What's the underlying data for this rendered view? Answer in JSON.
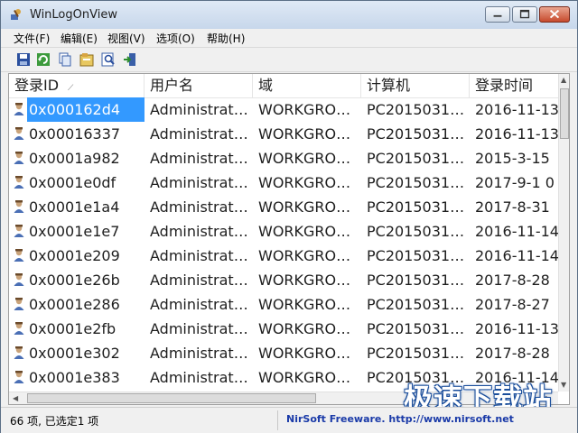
{
  "window": {
    "title": "WinLogOnView"
  },
  "menu": [
    {
      "label": "文件(F)"
    },
    {
      "label": "编辑(E)"
    },
    {
      "label": "视图(V)"
    },
    {
      "label": "选项(O)"
    },
    {
      "label": "帮助(H)"
    }
  ],
  "toolbar": [
    {
      "icon": "save-icon"
    },
    {
      "icon": "refresh-icon"
    },
    {
      "icon": "copy-icon"
    },
    {
      "icon": "properties-icon"
    },
    {
      "icon": "find-icon"
    },
    {
      "icon": "exit-icon"
    }
  ],
  "columns": [
    {
      "label": "登录ID",
      "sorted": true
    },
    {
      "label": "用户名"
    },
    {
      "label": "域"
    },
    {
      "label": "计算机"
    },
    {
      "label": "登录时间"
    }
  ],
  "rows": [
    {
      "id": "0x000162d4",
      "user": "Administrat…",
      "domain": "WORKGRO…",
      "computer": "PC2015031…",
      "time": "2016-11-13",
      "selected": true
    },
    {
      "id": "0x00016337",
      "user": "Administrat…",
      "domain": "WORKGRO…",
      "computer": "PC2015031…",
      "time": "2016-11-13"
    },
    {
      "id": "0x0001a982",
      "user": "Administrat…",
      "domain": "WORKGRO…",
      "computer": "PC2015031…",
      "time": "2015-3-15"
    },
    {
      "id": "0x0001e0df",
      "user": "Administrat…",
      "domain": "WORKGRO…",
      "computer": "PC2015031…",
      "time": "2017-9-1 0"
    },
    {
      "id": "0x0001e1a4",
      "user": "Administrat…",
      "domain": "WORKGRO…",
      "computer": "PC2015031…",
      "time": "2017-8-31"
    },
    {
      "id": "0x0001e1e7",
      "user": "Administrat…",
      "domain": "WORKGRO…",
      "computer": "PC2015031…",
      "time": "2016-11-14"
    },
    {
      "id": "0x0001e209",
      "user": "Administrat…",
      "domain": "WORKGRO…",
      "computer": "PC2015031…",
      "time": "2016-11-14"
    },
    {
      "id": "0x0001e26b",
      "user": "Administrat…",
      "domain": "WORKGRO…",
      "computer": "PC2015031…",
      "time": "2017-8-28"
    },
    {
      "id": "0x0001e286",
      "user": "Administrat…",
      "domain": "WORKGRO…",
      "computer": "PC2015031…",
      "time": "2017-8-27"
    },
    {
      "id": "0x0001e2fb",
      "user": "Administrat…",
      "domain": "WORKGRO…",
      "computer": "PC2015031…",
      "time": "2016-11-13"
    },
    {
      "id": "0x0001e302",
      "user": "Administrat…",
      "domain": "WORKGRO…",
      "computer": "PC2015031…",
      "time": "2017-8-28"
    },
    {
      "id": "0x0001e383",
      "user": "Administrat…",
      "domain": "WORKGRO…",
      "computer": "PC2015031…",
      "time": "2016-11-14"
    }
  ],
  "status": {
    "count": "66 项, 已选定1 项",
    "link": "NirSoft Freeware.  http://www.nirsoft.net"
  },
  "watermark": "极速下载站",
  "colors": {
    "selection": "#3399ff",
    "link": "#1a3aa8"
  }
}
